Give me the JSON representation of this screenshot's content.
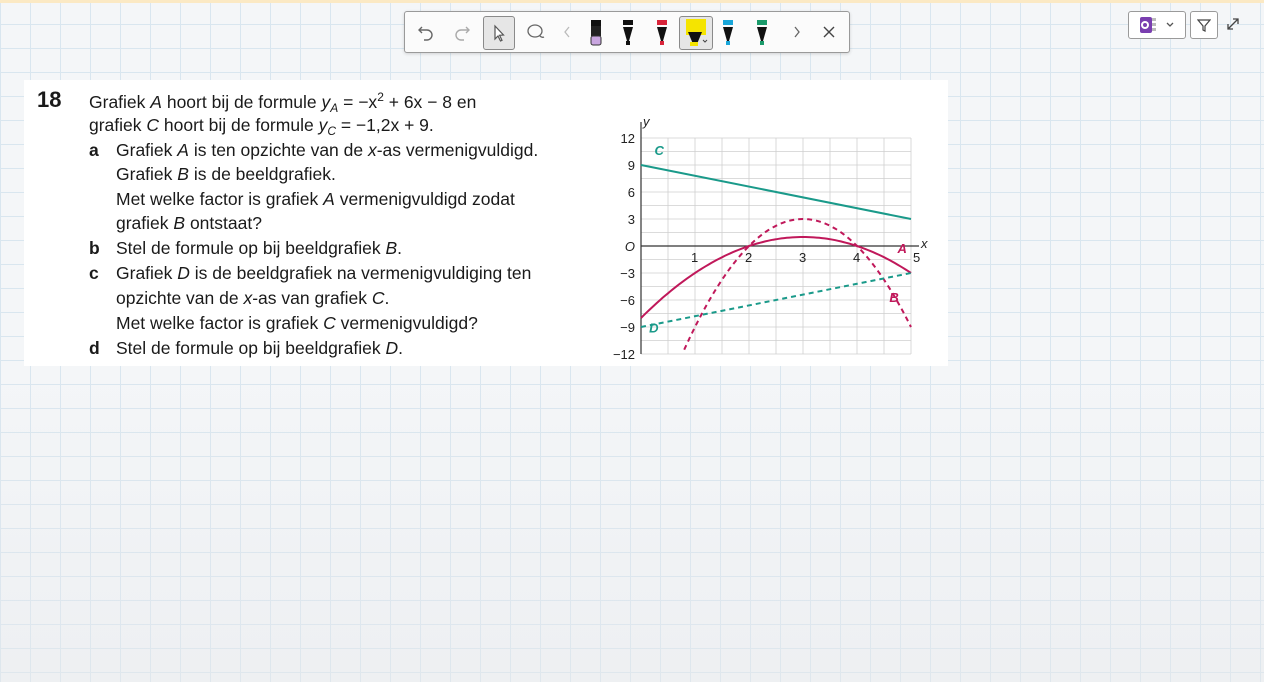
{
  "toolbar": {
    "tools": [
      "undo",
      "redo",
      "select",
      "lasso",
      "scroll-left",
      "pen-black-lilac",
      "pen-black",
      "pen-red",
      "highlighter-yellow",
      "pen-blue",
      "pen-green",
      "scroll-right",
      "close"
    ]
  },
  "right_buttons": [
    "notes-app-icon",
    "funnel-icon",
    "expand-icon"
  ],
  "question": {
    "number": "18",
    "intro": [
      {
        "a": "Grafiek ",
        "b": "A",
        "c": " hoort bij de formule ",
        "d": "y",
        "e": "A",
        "f": " = −x",
        "g": "2",
        "h": " + 6x − 8 en"
      },
      {
        "a": "grafiek ",
        "b": "C",
        "c": " hoort bij de formule ",
        "d": "y",
        "e": "C",
        "f": " = −1,2x + 9."
      }
    ],
    "parts": {
      "a": {
        "label": "a",
        "l1a": "Grafiek ",
        "l1b": "A",
        "l1c": " is ten opzichte van de ",
        "l1d": "x",
        "l1e": "-as vermenigvuldigd.",
        "l2a": "Grafiek ",
        "l2b": "B",
        "l2c": " is de beeldgrafiek.",
        "l3a": "Met welke factor is grafiek ",
        "l3b": "A",
        "l3c": " vermenigvuldigd zodat",
        "l4a": "grafiek ",
        "l4b": "B",
        "l4c": " ontstaat?"
      },
      "b": {
        "label": "b",
        "a": "Stel de formule op bij beeldgrafiek ",
        "b": "B",
        "c": "."
      },
      "c": {
        "label": "c",
        "l1a": "Grafiek ",
        "l1b": "D",
        "l1c": " is de beeldgrafiek na vermenigvuldiging ten",
        "l2a": "opzichte van de ",
        "l2b": "x",
        "l2c": "-as van grafiek ",
        "l2d": "C",
        "l2e": ".",
        "l3a": "Met welke factor is grafiek ",
        "l3b": "C",
        "l3c": " vermenigvuldigd?"
      },
      "d": {
        "label": "d",
        "a": "Stel de formule op bij beeldgrafiek ",
        "b": "D",
        "c": "."
      }
    }
  },
  "chart_data": {
    "type": "line",
    "xlabel": "x",
    "ylabel": "y",
    "xlim": [
      0,
      5
    ],
    "ylim": [
      -12,
      12
    ],
    "xticks": [
      "1",
      "2",
      "3",
      "4",
      "5"
    ],
    "yticks": [
      "12",
      "9",
      "6",
      "3",
      "O",
      "−3",
      "−6",
      "−9",
      "−12"
    ],
    "grid": true,
    "series": [
      {
        "name": "A",
        "formula": "-x^2+6x-8",
        "style": "solid",
        "color": "#c0185a",
        "x": [
          0,
          0.5,
          1,
          1.5,
          2,
          2.5,
          3,
          3.5,
          4,
          4.5,
          5
        ],
        "y": [
          -8,
          -5.25,
          -3,
          -1.25,
          0,
          0.75,
          1,
          0.75,
          0,
          -1.25,
          -3
        ]
      },
      {
        "name": "B",
        "style": "dashed",
        "color": "#c0185a",
        "x": [
          0.8,
          1,
          1.5,
          2,
          2.5,
          3,
          3.5,
          4,
          4.5,
          5
        ],
        "y": [
          -11.8,
          -9,
          -3.75,
          0,
          2.25,
          3,
          2.25,
          0,
          -3.75,
          -9
        ]
      },
      {
        "name": "C",
        "formula": "-1.2x+9",
        "style": "solid",
        "color": "#1a9a8a",
        "x": [
          0,
          5
        ],
        "y": [
          9,
          3
        ]
      },
      {
        "name": "D",
        "style": "dashed",
        "color": "#1a9a8a",
        "x": [
          0,
          5
        ],
        "y": [
          -9,
          -3
        ]
      }
    ]
  },
  "colors": {
    "accent_curve": "#c0185a",
    "accent_line": "#1a9a8a",
    "highlighter": "#f5e400"
  }
}
